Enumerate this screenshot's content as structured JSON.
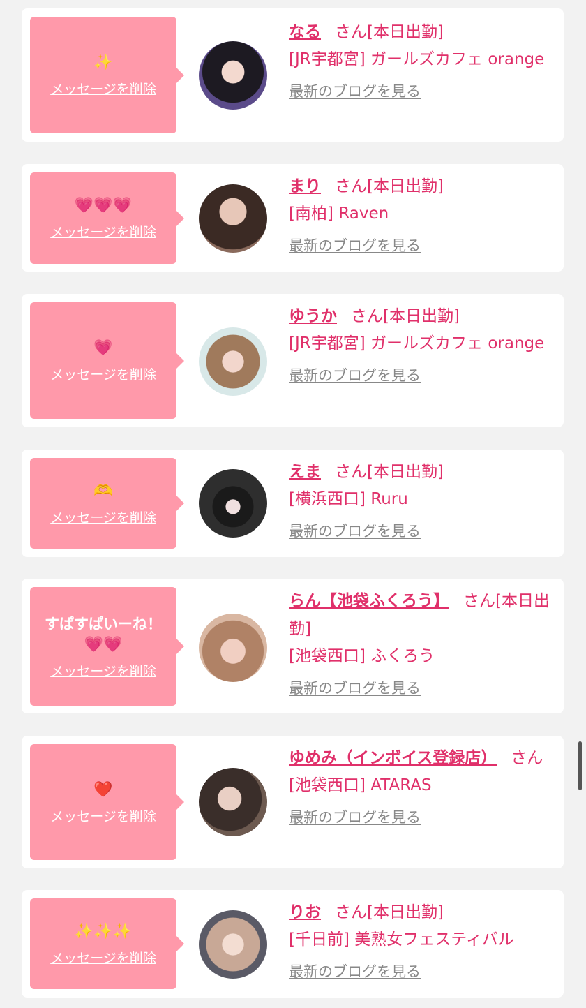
{
  "delete_label": "メッセージを削除",
  "blog_label": "最新のブログを見る",
  "san_label": "さん",
  "attendance_label": "[本日出勤]",
  "colors": {
    "accent": "#e0306a",
    "bubble": "#ff99aa",
    "background": "#f2f2f2"
  },
  "cards": [
    {
      "name": "なる",
      "shop": "[JR宇都宮] ガールズカフェ orange",
      "message": "✨",
      "avatar_icon": "avatar-photo"
    },
    {
      "name": "まり",
      "shop": "[南柏] Raven",
      "message": "💗💗💗",
      "avatar_icon": "avatar-photo"
    },
    {
      "name": "ゆうか",
      "shop": "[JR宇都宮] ガールズカフェ orange",
      "message": "💗",
      "avatar_icon": "avatar-photo"
    },
    {
      "name": "えま",
      "shop": "[横浜西口] Ruru",
      "message": "🫶",
      "avatar_icon": "avatar-photo"
    },
    {
      "name": "らん【池袋ふくろう】",
      "shop": "[池袋西口] ふくろう",
      "message_text": "すぱすぱいーね！",
      "message": "💗💗",
      "avatar_icon": "avatar-photo"
    },
    {
      "name": "ゆめみ（インボイス登録店）",
      "shop": "[池袋西口] ATARAS",
      "message": "❤️",
      "avatar_icon": "avatar-photo"
    },
    {
      "name": "りお",
      "shop": "[千日前] 美熟女フェスティバル",
      "message": "✨✨✨",
      "avatar_icon": "avatar-photo"
    }
  ]
}
